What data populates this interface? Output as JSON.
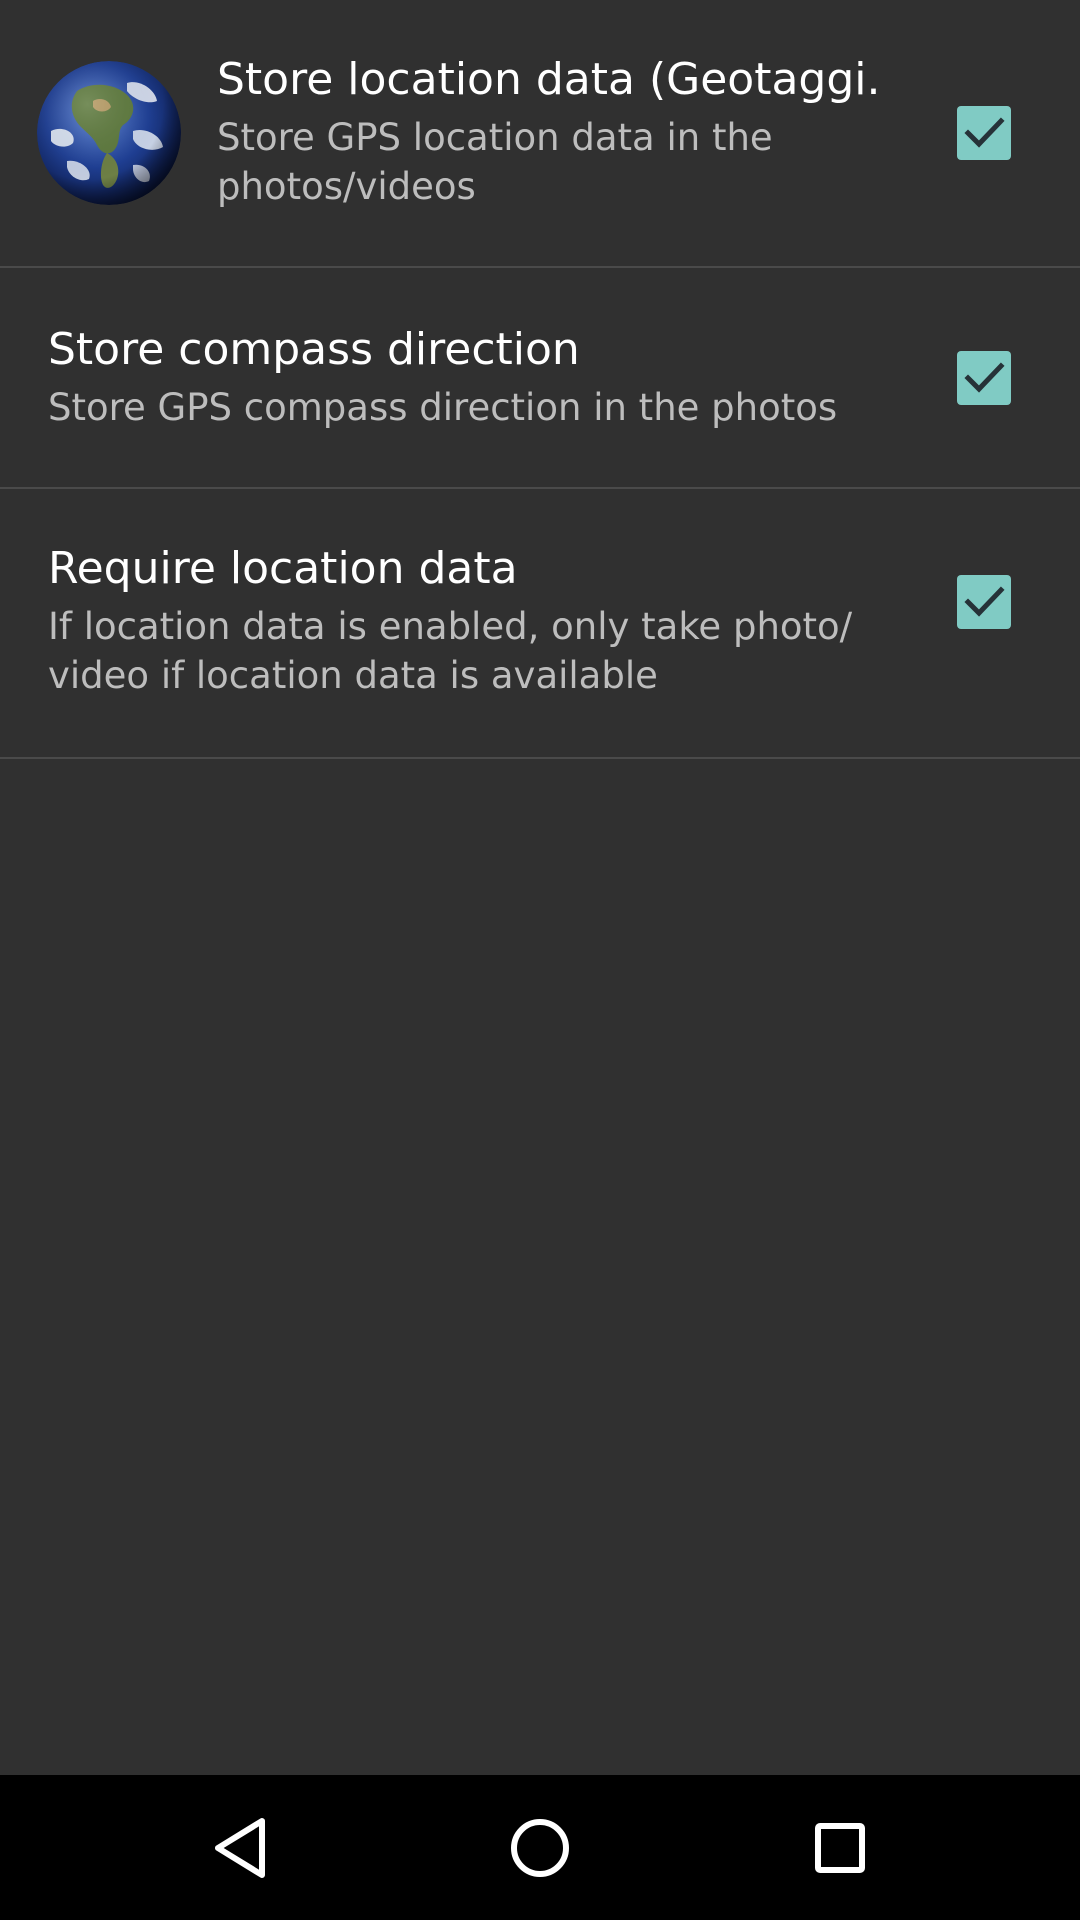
{
  "preferences": [
    {
      "title": "Store location data (Geotaggi..",
      "summary": "Store GPS location data in the photos/videos",
      "checked": true,
      "icon": "globe-icon"
    },
    {
      "title": "Store compass direction",
      "summary": "Store GPS compass direction in the photos",
      "checked": true
    },
    {
      "title": "Require location data",
      "summary": "If location data is enabled, only take photo/ video if location data is available",
      "checked": true
    }
  ],
  "colors": {
    "background": "#303030",
    "checkbox_accent": "#80cbc4",
    "divider": "#4a4a4a",
    "title_text": "#ffffff",
    "summary_text": "#bdbdbd",
    "navbar": "#000000"
  },
  "navigation_bar": {
    "back_icon": "back-triangle-icon",
    "home_icon": "home-circle-icon",
    "recents_icon": "recents-square-icon"
  }
}
